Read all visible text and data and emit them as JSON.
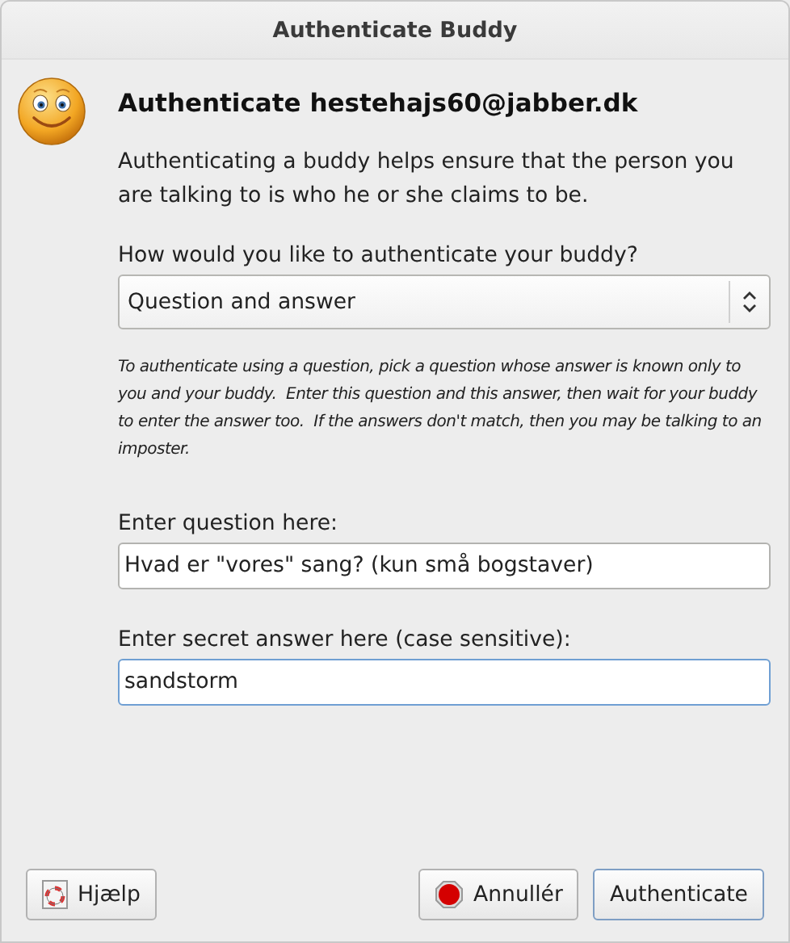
{
  "window": {
    "title": "Authenticate Buddy"
  },
  "heading": "Authenticate hestehajs60@jabber.dk",
  "description": "Authenticating a buddy helps ensure that the person you are talking to is who he or she claims to be.",
  "method": {
    "label": "How would you like to authenticate your buddy?",
    "value": "Question and answer"
  },
  "instructions": "To authenticate using a question, pick a question whose answer is known only to you and your buddy.  Enter this question and this answer, then wait for your buddy to enter the answer too.  If the answers don't match, then you may be talking to an imposter.",
  "fields": [
    {
      "label": "Enter question here:",
      "value": "Hvad er \"vores\" sang? (kun små bogstaver)",
      "focused": false
    },
    {
      "label": "Enter secret answer here (case sensitive):",
      "value": "sandstorm",
      "focused": true
    }
  ],
  "buttons": [
    {
      "kind": "help",
      "label": "Hjælp",
      "default": false
    },
    {
      "kind": "cancel",
      "label": "Annullér",
      "default": false
    },
    {
      "kind": "plain",
      "label": "Authenticate",
      "default": true
    }
  ]
}
